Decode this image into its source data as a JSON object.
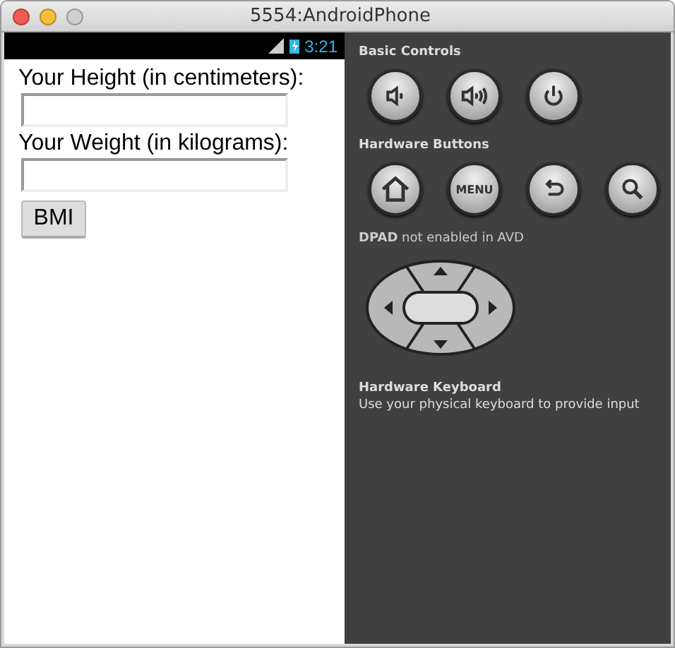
{
  "window": {
    "title": "5554:AndroidPhone"
  },
  "status_bar": {
    "time": "3:21"
  },
  "form": {
    "fields": [
      {
        "label": "Your Height (in centimeters):"
      },
      {
        "label": "Your Weight (in kilograms):"
      }
    ],
    "button": "BMI"
  },
  "controls": {
    "basic_title": "Basic Controls",
    "basic": [
      {
        "kind": "volume-down"
      },
      {
        "kind": "volume-up"
      },
      {
        "kind": "power"
      }
    ],
    "hardware_title": "Hardware Buttons",
    "hardware": [
      {
        "kind": "home"
      },
      {
        "kind": "menu",
        "label": "MENU"
      },
      {
        "kind": "back"
      },
      {
        "kind": "search"
      }
    ],
    "dpad_title": "**DPAD** not enabled in AVD",
    "keyboard_title": "Hardware Keyboard",
    "keyboard_hint": "Use your physical keyboard to provide input"
  }
}
